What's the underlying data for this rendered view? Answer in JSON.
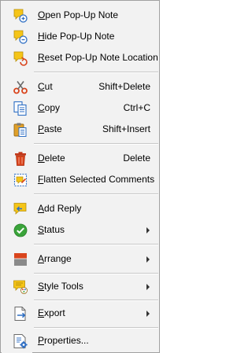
{
  "menu": {
    "items": [
      {
        "label": "Open Pop-Up Note",
        "icon": "open-popup-note-icon"
      },
      {
        "label": "Hide Pop-Up Note",
        "icon": "hide-popup-note-icon"
      },
      {
        "label": "Reset Pop-Up Note Location",
        "icon": "reset-popup-note-location-icon"
      },
      {
        "label": "Cut",
        "shortcut": "Shift+Delete",
        "icon": "scissors-icon"
      },
      {
        "label": "Copy",
        "shortcut": "Ctrl+C",
        "icon": "copy-icon"
      },
      {
        "label": "Paste",
        "shortcut": "Shift+Insert",
        "icon": "paste-icon"
      },
      {
        "label": "Delete",
        "shortcut": "Delete",
        "icon": "trash-icon"
      },
      {
        "label": "Flatten Selected Comments",
        "icon": "flatten-comments-icon"
      },
      {
        "label": "Add Reply",
        "icon": "add-reply-icon"
      },
      {
        "label": "Status",
        "icon": "checkmark-status-icon"
      },
      {
        "label": "Arrange",
        "icon": "arrange-icon"
      },
      {
        "label": "Style Tools",
        "icon": "style-tools-icon"
      },
      {
        "label": "Export",
        "icon": "export-icon"
      },
      {
        "label": "Properties...",
        "icon": "properties-icon"
      }
    ]
  },
  "colors": {
    "menu_background": "#f2f2f2",
    "border": "#a0a0a0",
    "note_yellow": "#f5c518",
    "accent_blue": "#2f6fc4",
    "delete_red": "#d9441c",
    "status_green": "#3aa43a"
  }
}
